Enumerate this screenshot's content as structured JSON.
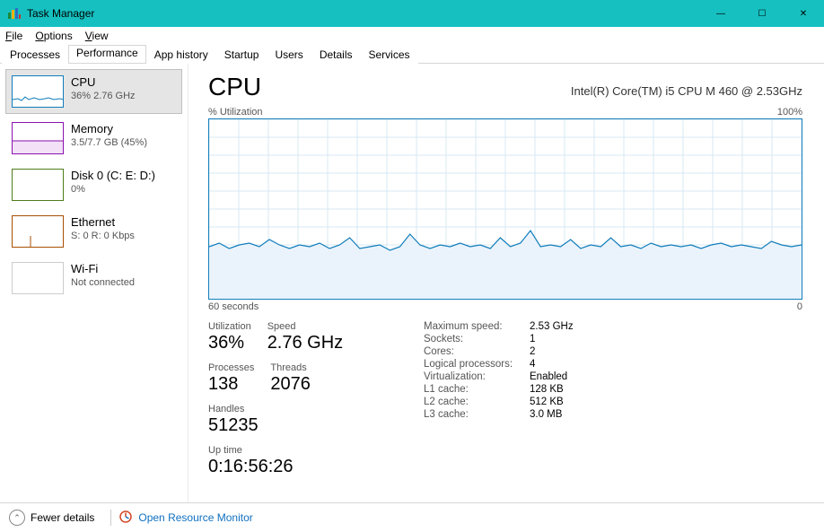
{
  "window": {
    "title": "Task Manager"
  },
  "window_controls": {
    "min": "—",
    "max": "☐",
    "close": "✕"
  },
  "menubar": {
    "file": "File",
    "options": "Options",
    "view": "View"
  },
  "tabs": [
    {
      "label": "Processes"
    },
    {
      "label": "Performance"
    },
    {
      "label": "App history"
    },
    {
      "label": "Startup"
    },
    {
      "label": "Users"
    },
    {
      "label": "Details"
    },
    {
      "label": "Services"
    }
  ],
  "sidebar": [
    {
      "title": "CPU",
      "sub": "36% 2.76 GHz"
    },
    {
      "title": "Memory",
      "sub": "3.5/7.7 GB (45%)"
    },
    {
      "title": "Disk 0 (C: E: D:)",
      "sub": "0%"
    },
    {
      "title": "Ethernet",
      "sub": "S: 0 R: 0 Kbps"
    },
    {
      "title": "Wi-Fi",
      "sub": "Not connected"
    }
  ],
  "main": {
    "heading": "CPU",
    "device": "Intel(R) Core(TM) i5 CPU M 460 @ 2.53GHz",
    "chart_top_left": "% Utilization",
    "chart_top_right": "100%",
    "chart_bottom_left": "60 seconds",
    "chart_bottom_right": "0",
    "stats_left": {
      "utilization_label": "Utilization",
      "utilization_value": "36%",
      "speed_label": "Speed",
      "speed_value": "2.76 GHz",
      "processes_label": "Processes",
      "processes_value": "138",
      "threads_label": "Threads",
      "threads_value": "2076",
      "handles_label": "Handles",
      "handles_value": "51235",
      "uptime_label": "Up time",
      "uptime_value": "0:16:56:26"
    },
    "stats_right": [
      {
        "k": "Maximum speed:",
        "v": "2.53 GHz"
      },
      {
        "k": "Sockets:",
        "v": "1"
      },
      {
        "k": "Cores:",
        "v": "2"
      },
      {
        "k": "Logical processors:",
        "v": "4"
      },
      {
        "k": "Virtualization:",
        "v": "Enabled"
      },
      {
        "k": "L1 cache:",
        "v": "128 KB"
      },
      {
        "k": "L2 cache:",
        "v": "512 KB"
      },
      {
        "k": "L3 cache:",
        "v": "3.0 MB"
      }
    ]
  },
  "footer": {
    "fewer": "Fewer details",
    "resource_monitor": "Open Resource Monitor"
  },
  "chart_data": {
    "type": "area",
    "title": "% Utilization",
    "x": [
      "60 seconds",
      "0"
    ],
    "ylim": [
      0,
      100
    ],
    "ylabel": "% Utilization",
    "series": [
      {
        "name": "CPU %",
        "values": [
          29,
          31,
          28,
          30,
          31,
          29,
          33,
          30,
          28,
          30,
          29,
          31,
          28,
          30,
          34,
          28,
          29,
          30,
          27,
          29,
          36,
          30,
          28,
          30,
          29,
          31,
          29,
          30,
          28,
          34,
          29,
          31,
          38,
          29,
          30,
          29,
          33,
          28,
          30,
          29,
          34,
          29,
          30,
          28,
          31,
          29,
          30,
          29,
          30,
          28,
          30,
          31,
          29,
          30,
          29,
          28,
          32,
          30,
          29,
          30
        ]
      }
    ]
  }
}
